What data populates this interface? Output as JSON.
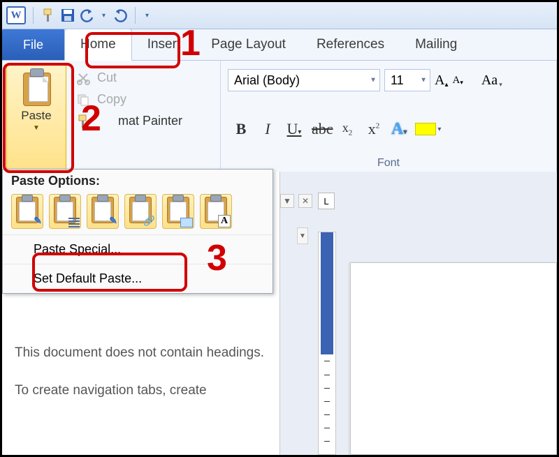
{
  "qat": {
    "word_letter": "W"
  },
  "tabs": {
    "file": "File",
    "home": "Home",
    "insert": "Insert",
    "page_layout": "Page Layout",
    "references": "References",
    "mailings": "Mailing"
  },
  "clipboard": {
    "paste": "Paste",
    "cut": "Cut",
    "copy": "Copy",
    "format_painter": "Format Painter"
  },
  "font": {
    "name": "Arial (Body)",
    "size": "11",
    "group_label": "Font"
  },
  "paste_menu": {
    "header": "Paste Options:",
    "paste_special": "Paste Special...",
    "set_default": "Set Default Paste..."
  },
  "nav_pane": {
    "para1": "This document does not contain headings.",
    "para2": "To create navigation tabs, create"
  },
  "doc": {
    "tab_marker": "L"
  },
  "annotations": {
    "n1": "1",
    "n2": "2",
    "n3": "3"
  }
}
